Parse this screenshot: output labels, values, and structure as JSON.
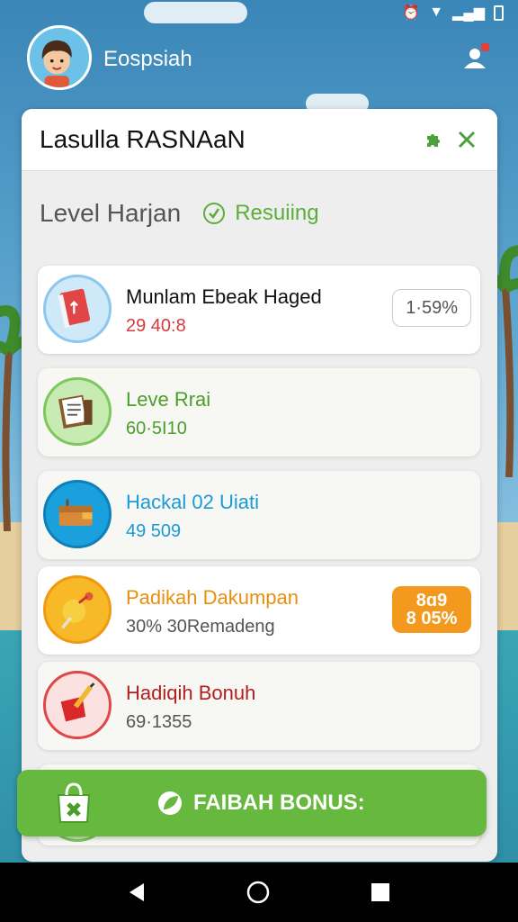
{
  "colors": {
    "accent_green": "#67b83f",
    "red": "#d83a3a",
    "blue": "#1a9ad6",
    "orange": "#e8900e",
    "dark_red": "#b31f1f"
  },
  "header": {
    "username": "Eospsiah"
  },
  "panel": {
    "title": "Lasulla RASNAaN",
    "level_label": "Level Harjan",
    "status_label": "Resuiing"
  },
  "items": [
    {
      "title": "Munlam Ebeak Haged",
      "subtitle": "29  40:8",
      "badge": "1·59%",
      "icon": "book-icon"
    },
    {
      "title": "Leve Rrai",
      "subtitle": "60·5I10",
      "icon": "notebook-icon"
    },
    {
      "title": "Hackal 02 Uiati",
      "subtitle": "49  509",
      "icon": "wallet-icon"
    },
    {
      "title": "Padikah Dakumpan",
      "subtitle": "30%  30Remadeng",
      "badge": "8ɑ9 8 05%",
      "icon": "star-wand-icon"
    },
    {
      "title": "Hadiqih Bonuh",
      "subtitle": "69·1355",
      "icon": "pencil-box-icon"
    }
  ],
  "bonus": {
    "label": "FAIBAH  BONUS:"
  }
}
